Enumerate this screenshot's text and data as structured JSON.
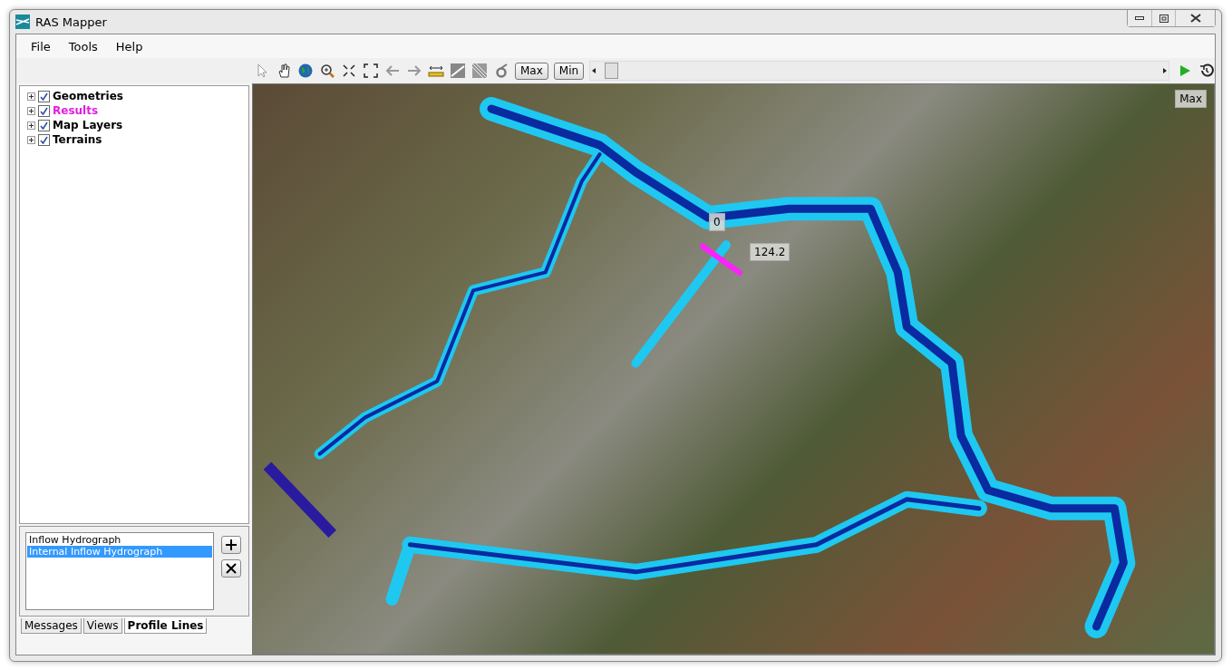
{
  "window": {
    "title": "RAS Mapper"
  },
  "menu": [
    "File",
    "Tools",
    "Help"
  ],
  "toolbar": {
    "buttons": [
      "Max",
      "Min"
    ]
  },
  "tree": [
    {
      "label": "Geometries",
      "checked": true,
      "color": "#000000"
    },
    {
      "label": "Results",
      "checked": true,
      "color": "#e020e0"
    },
    {
      "label": "Map Layers",
      "checked": true,
      "color": "#000000"
    },
    {
      "label": "Terrains",
      "checked": true,
      "color": "#000000"
    }
  ],
  "profile_lines": [
    {
      "label": "Inflow Hydrograph",
      "selected": false
    },
    {
      "label": "Internal Inflow Hydrograph",
      "selected": true
    }
  ],
  "tabs": [
    {
      "label": "Messages",
      "selected": false
    },
    {
      "label": "Views",
      "selected": false
    },
    {
      "label": "Profile Lines",
      "selected": true
    }
  ],
  "map": {
    "max_label": "Max",
    "profile_labels": [
      "0",
      "124.2"
    ]
  }
}
